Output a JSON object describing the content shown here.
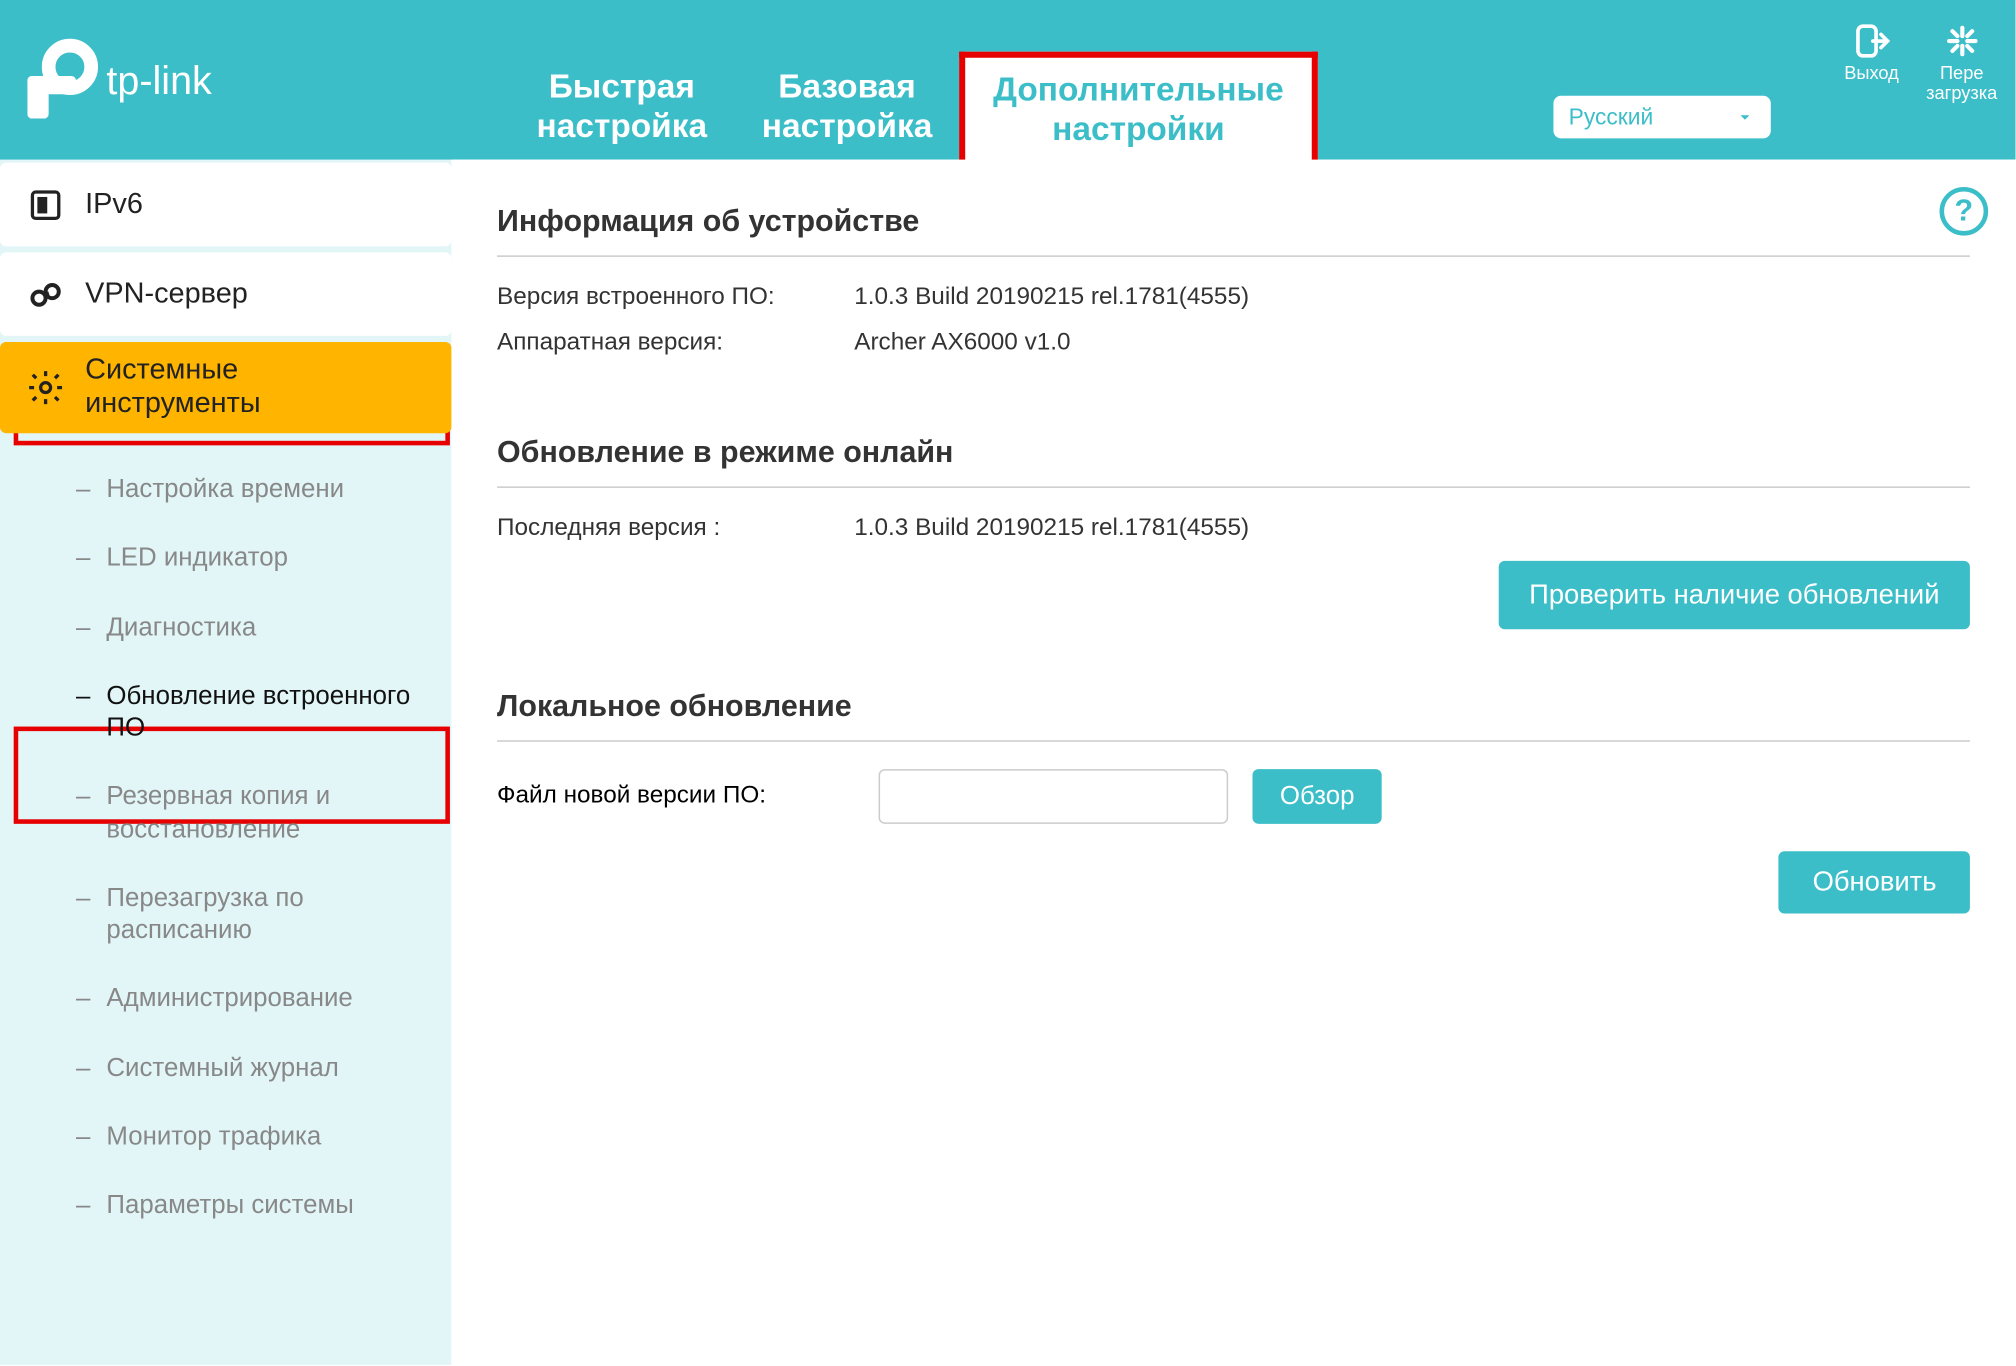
{
  "header": {
    "brand": "tp-link",
    "tabs": [
      {
        "label": "Быстрая\nнастройка"
      },
      {
        "label": "Базовая\nнастройка"
      },
      {
        "label": "Дополнительные\nнастройки"
      }
    ],
    "lang": "Русский",
    "logout": "Выход",
    "reboot": "Пере\nзагрузка"
  },
  "sidebar": {
    "items": [
      {
        "label": "IPv6"
      },
      {
        "label": "VPN-сервер"
      },
      {
        "label": "Системные\nинструменты"
      }
    ],
    "sub": [
      {
        "label": "Настройка времени"
      },
      {
        "label": "LED индикатор"
      },
      {
        "label": "Диагностика"
      },
      {
        "label": "Обновление встроенного ПО"
      },
      {
        "label": "Резервная копия и восстановление"
      },
      {
        "label": "Перезагрузка по расписанию"
      },
      {
        "label": "Администрирование"
      },
      {
        "label": "Системный журнал"
      },
      {
        "label": "Монитор трафика"
      },
      {
        "label": "Параметры системы"
      }
    ]
  },
  "content": {
    "device_info_title": "Информация об устройстве",
    "fw_label": "Версия встроенного ПО:",
    "fw_value": "1.0.3 Build 20190215 rel.1781(4555)",
    "hw_label": "Аппаратная версия:",
    "hw_value": "Archer AX6000 v1.0",
    "online_title": "Обновление в режиме онлайн",
    "latest_label": "Последняя версия :",
    "latest_value": "1.0.3 Build 20190215 rel.1781(4555)",
    "check_btn": "Проверить наличие обновлений",
    "local_title": "Локальное обновление",
    "file_label": "Файл новой версии ПО:",
    "browse_btn": "Обзор",
    "update_btn": "Обновить"
  }
}
